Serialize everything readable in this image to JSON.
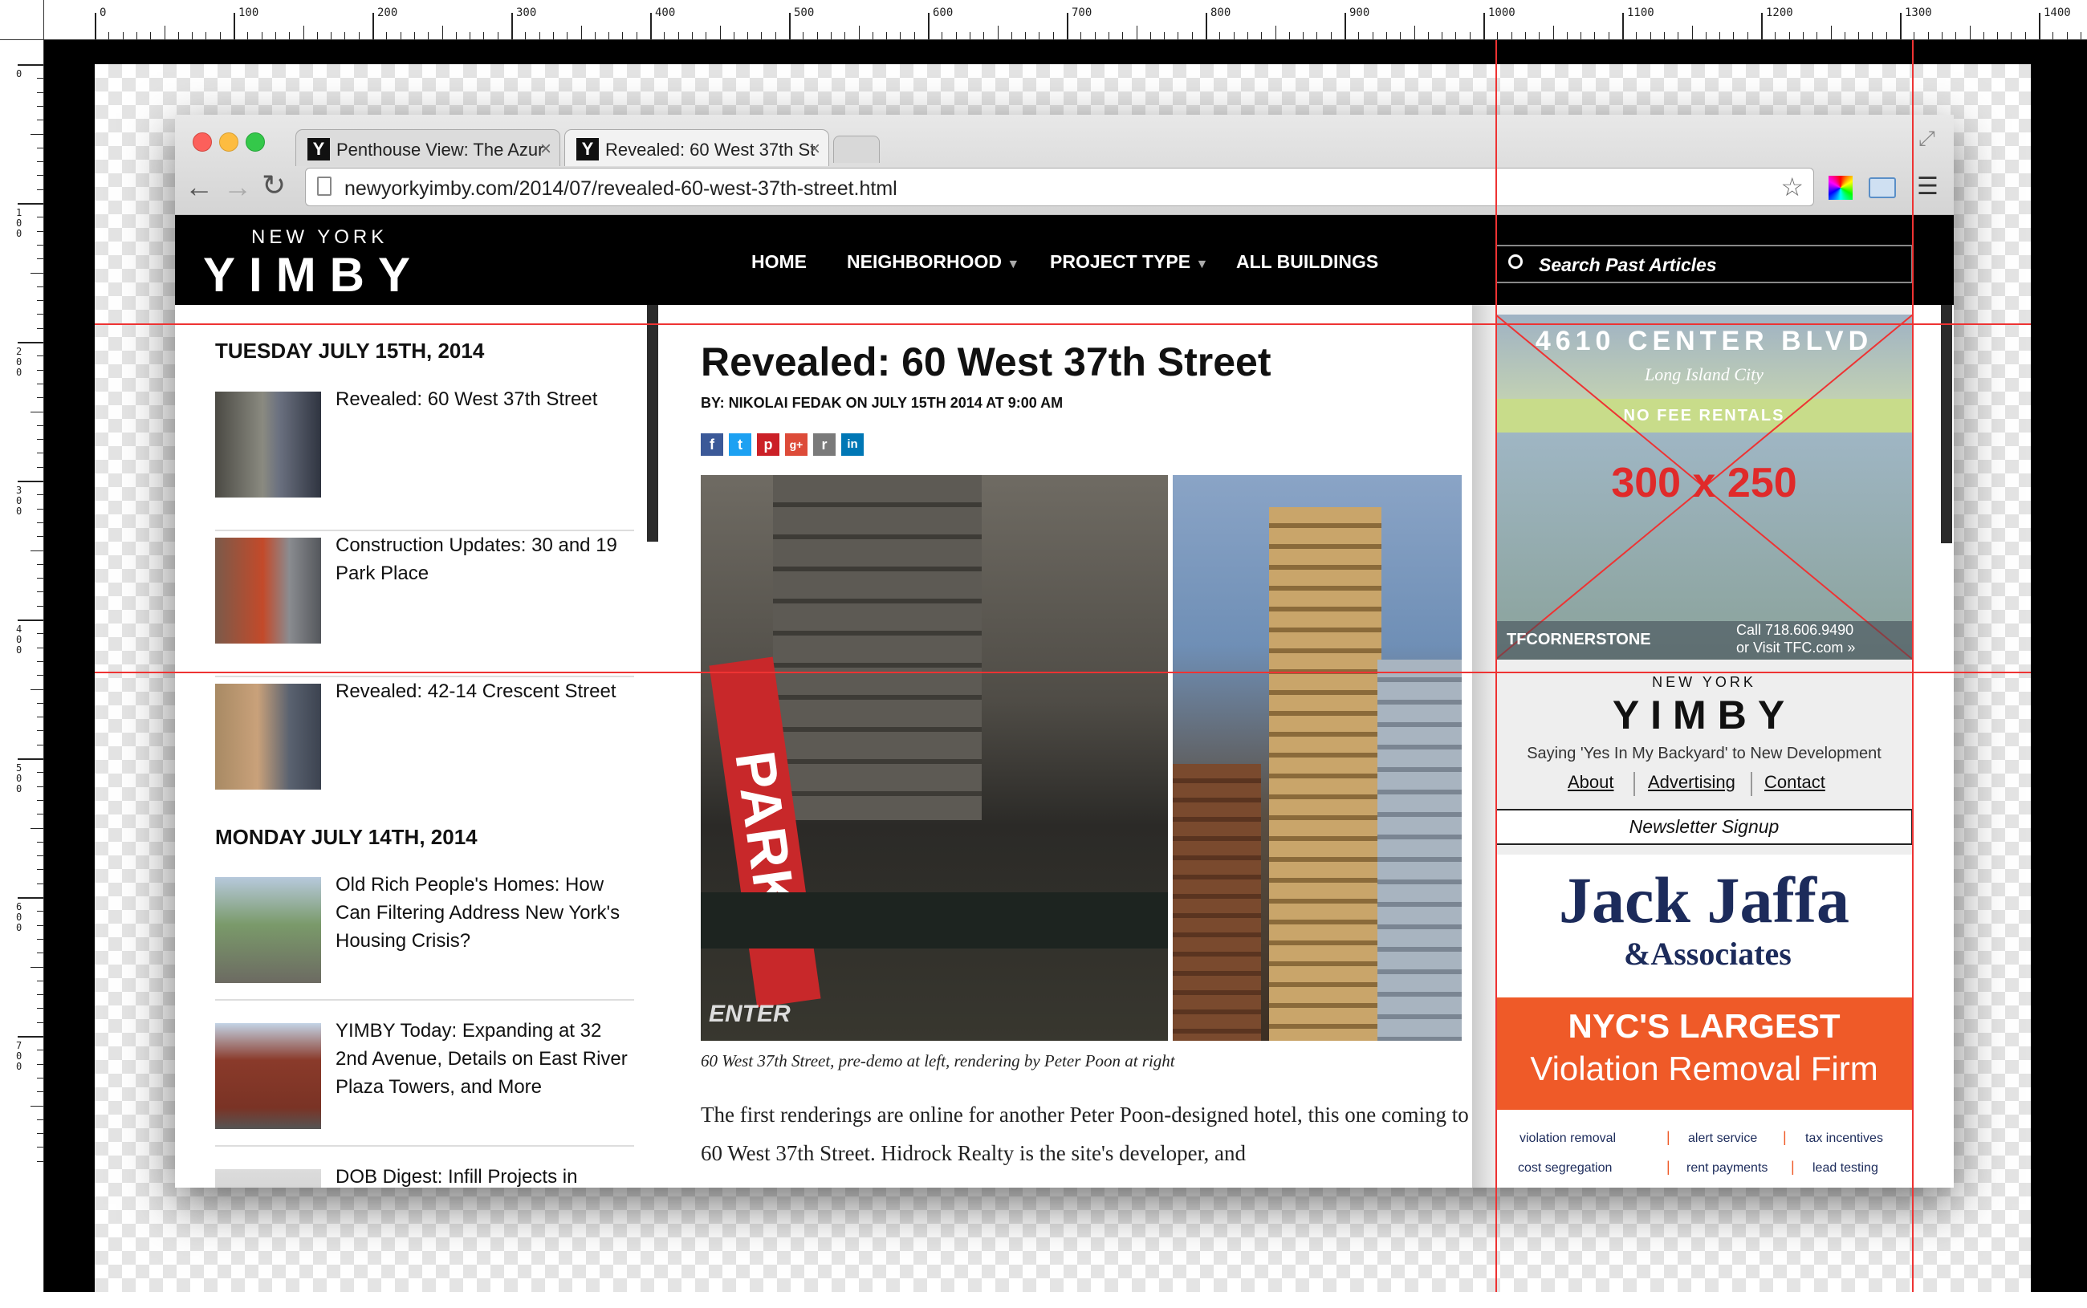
{
  "ruler": {
    "top_labels": [
      "0",
      "100",
      "200",
      "300",
      "400",
      "500",
      "600",
      "700",
      "800",
      "900",
      "1000",
      "1100",
      "1200",
      "1300",
      "1400"
    ],
    "left_labels": [
      "0",
      "100",
      "200",
      "300",
      "400",
      "500",
      "600",
      "700"
    ]
  },
  "browser": {
    "tabs": [
      {
        "favicon": "Y",
        "title": "Penthouse View: The Azur",
        "close": "×"
      },
      {
        "favicon": "Y",
        "title": "Revealed: 60 West 37th St",
        "close": "×"
      }
    ],
    "url": "newyorkyimby.com/2014/07/revealed-60-west-37th-street.html",
    "nav_icons": [
      "back-arrow-icon",
      "forward-arrow-icon",
      "reload-icon"
    ],
    "right_icons": [
      "star-icon",
      "color-picker-icon",
      "extension-icon",
      "menu-icon"
    ],
    "expand_icon": "⤢"
  },
  "site": {
    "logo_small": "NEW YORK",
    "logo_big": "YIMBY",
    "nav": [
      "HOME",
      "NEIGHBORHOOD",
      "PROJECT TYPE",
      "ALL BUILDINGS"
    ],
    "search_placeholder": "Search Past Articles"
  },
  "left_column": {
    "days": [
      {
        "heading": "TUESDAY JULY 15TH, 2014",
        "posts": [
          "Revealed: 60 West 37th Street",
          "Construction Updates: 30 and 19 Park Place",
          "Revealed: 42-14 Crescent Street"
        ]
      },
      {
        "heading": "MONDAY JULY 14TH, 2014",
        "posts": [
          "Old Rich People's Homes: How Can Filtering Address New York's Housing Crisis?",
          "YIMBY Today: Expanding at 32 2nd Avenue, Details on East River Plaza Towers, and More",
          "DOB Digest: Infill Projects in"
        ]
      }
    ]
  },
  "article": {
    "title": "Revealed: 60 West 37th Street",
    "byline": "BY: NIKOLAI FEDAK ON JULY 15TH 2014 AT 9:00 AM",
    "share": [
      "f",
      "t",
      "p",
      "g+",
      "r",
      "in"
    ],
    "photo_left_text": "PARK",
    "photo_left_sign2": "ENTER",
    "caption": "60 West 37th Street, pre-demo at left, rendering by Peter Poon at right",
    "body": "The first renderings are online for another Peter Poon-designed hotel, this one coming to 60 West 37th Street. Hidrock Realty is the site's developer, and"
  },
  "sidebar": {
    "ad": {
      "headline": "4610 CENTER BLVD",
      "subline": "Long Island City",
      "band": "NO FEE RENTALS",
      "placeholder": "300 x 250",
      "brand": "TFCORNERSTONE",
      "call": "Call 718.606.9490",
      "visit": "or Visit TFC.com »"
    },
    "box": {
      "small": "NEW YORK",
      "big": "YIMBY",
      "tagline": "Saying 'Yes In My Backyard' to New Development",
      "links": [
        "About",
        "Advertising",
        "Contact"
      ]
    },
    "newsletter": "Newsletter Signup",
    "jj": {
      "name": "Jack Jaffa",
      "assoc": "&Associates",
      "headline1": "NYC'S LARGEST",
      "headline2": "Violation Removal Firm",
      "services_row1": [
        "violation removal",
        "alert service",
        "tax incentives"
      ],
      "services_row2": [
        "cost segregation",
        "rent payments",
        "lead testing"
      ]
    }
  },
  "colors": {
    "guide": "#e33333",
    "jj_navy": "#1c2b5b",
    "jj_orange": "#ef5a28",
    "facebook": "#3b5998",
    "twitter": "#1da1f2",
    "pinterest": "#cb2027",
    "gplus": "#dd4b39",
    "reddit": "#7a7a7a",
    "linkedin": "#0077b5"
  }
}
